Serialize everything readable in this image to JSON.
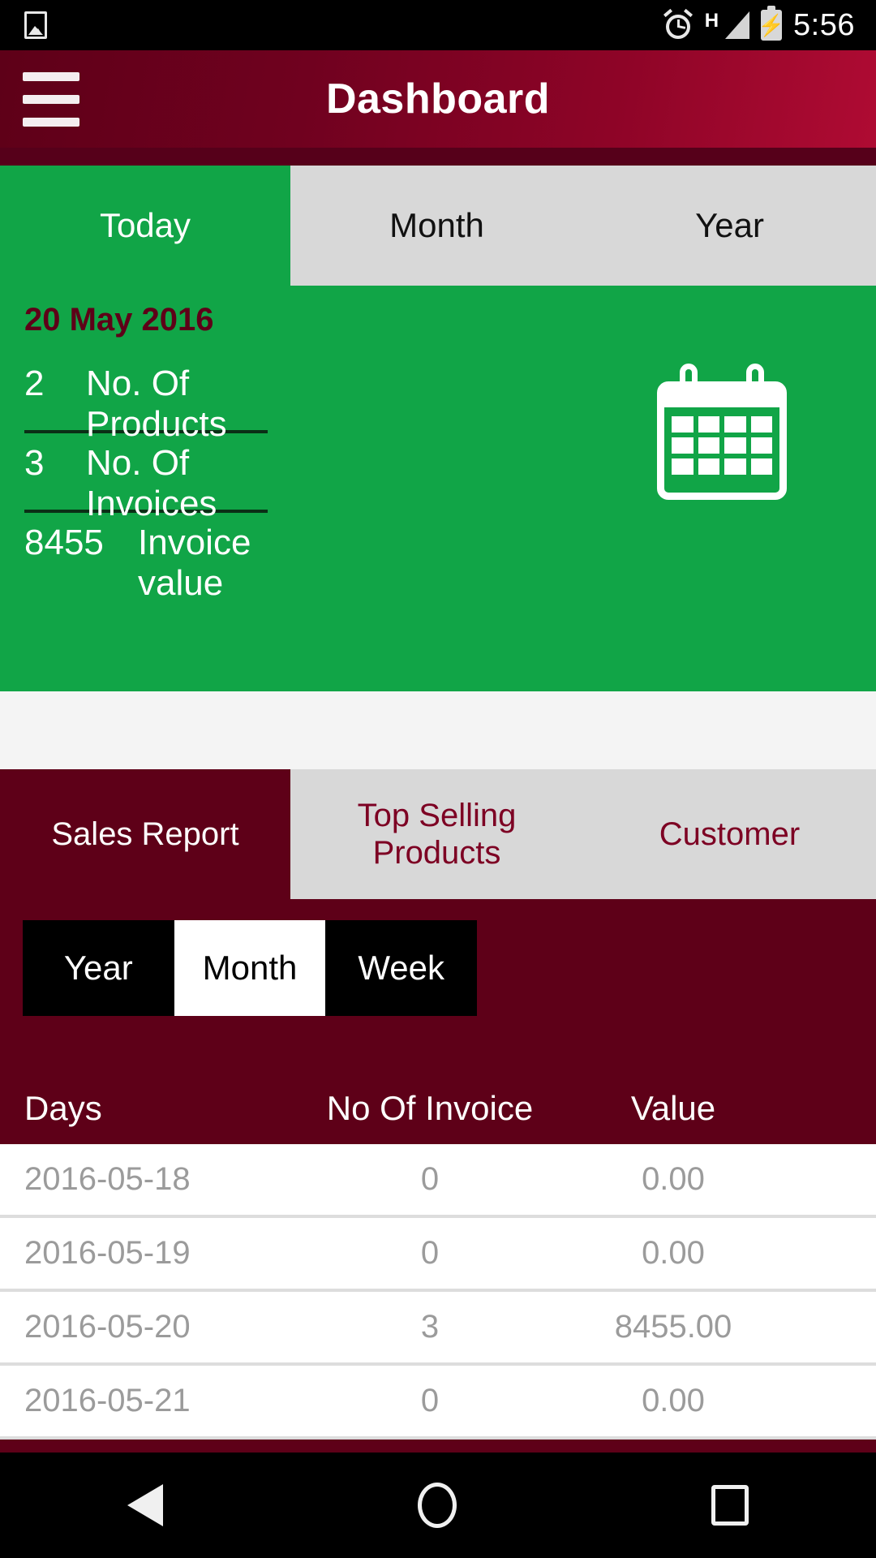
{
  "statusbar": {
    "photo_icon": "photo-icon",
    "alarm_icon": "alarm-icon",
    "network_type": "H",
    "signal_icon": "signal-bars-icon",
    "battery_icon": "battery-charging-icon",
    "battery_glyph": "⚡",
    "time": "5:56"
  },
  "appbar": {
    "menu_icon": "hamburger-menu-icon",
    "title": "Dashboard"
  },
  "period_tabs": {
    "items": [
      {
        "label": "Today",
        "active": true
      },
      {
        "label": "Month",
        "active": false
      },
      {
        "label": "Year",
        "active": false
      }
    ]
  },
  "summary": {
    "date": "20 May 2016",
    "calendar_icon": "calendar-icon",
    "stats": [
      {
        "value": "2",
        "label": "No. Of Products"
      },
      {
        "value": "3",
        "label": "No. Of Invoices"
      },
      {
        "value": "8455",
        "label": "Invoice value"
      }
    ]
  },
  "report_tabs": {
    "items": [
      {
        "label": "Sales Report",
        "active": true
      },
      {
        "label": "Top Selling Products",
        "active": false
      },
      {
        "label": "Customer",
        "active": false
      }
    ]
  },
  "range_segment": {
    "options": [
      {
        "label": "Year",
        "selected": false
      },
      {
        "label": "Month",
        "selected": true
      },
      {
        "label": "Week",
        "selected": false
      }
    ],
    "selected": "Month"
  },
  "table": {
    "columns": [
      "Days",
      "No Of Invoice",
      "Value"
    ],
    "rows": [
      {
        "day": "2016-05-18",
        "invoices": "0",
        "value": "0.00"
      },
      {
        "day": "2016-05-19",
        "invoices": "0",
        "value": "0.00"
      },
      {
        "day": "2016-05-20",
        "invoices": "3",
        "value": "8455.00"
      },
      {
        "day": "2016-05-21",
        "invoices": "0",
        "value": "0.00"
      }
    ]
  },
  "navbar": {
    "back": "back-icon",
    "home": "home-icon",
    "recents": "recents-icon"
  },
  "colors": {
    "brand_maroon": "#5e0018",
    "brand_crimson": "#af0b33",
    "green": "#11a547",
    "tab_idle": "#d8d8d8",
    "row_text": "#9b9b9b"
  }
}
